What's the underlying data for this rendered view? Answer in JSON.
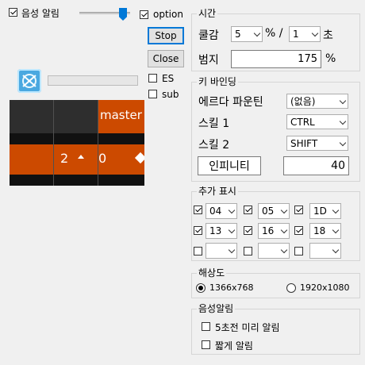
{
  "voice_alert": {
    "label": "음성 알림",
    "checked": true
  },
  "option": {
    "label": "option",
    "checked": true
  },
  "buttons": {
    "stop": "Stop",
    "close": "Close"
  },
  "es": {
    "label": "ES",
    "checked": false
  },
  "sub": {
    "label": "sub",
    "checked": false
  },
  "preview": {
    "top_text": "master",
    "bottom_value": "2",
    "bottom_right": "0",
    "colors": {
      "orange": "#cc4a00",
      "dark": "#2e2e2e"
    }
  },
  "time": {
    "title": "시간",
    "cooldown_label": "쿨감",
    "cooldown_value": "5",
    "percent_sep": "% /",
    "second_value": "1",
    "second_unit": "초",
    "width_label": "범지",
    "width_value": "175",
    "width_unit": "%"
  },
  "keybind": {
    "title": "키 바인딩",
    "rows": [
      {
        "label": "에르다 파운틴",
        "value": "(없음)"
      },
      {
        "label": "스킬 1",
        "value": "CTRL"
      },
      {
        "label": "스킬 2",
        "value": "SHIFT"
      }
    ],
    "infinity_label": "인피니티",
    "infinity_value": "40"
  },
  "extra": {
    "title": "추가 표시",
    "rows": [
      [
        {
          "checked": true,
          "value": "04"
        },
        {
          "checked": true,
          "value": "05"
        },
        {
          "checked": true,
          "value": "1D"
        }
      ],
      [
        {
          "checked": true,
          "value": "13"
        },
        {
          "checked": true,
          "value": "16"
        },
        {
          "checked": true,
          "value": "18"
        }
      ],
      [
        {
          "checked": false,
          "value": ""
        },
        {
          "checked": false,
          "value": ""
        },
        {
          "checked": false,
          "value": ""
        }
      ]
    ]
  },
  "resolution": {
    "title": "해상도",
    "opt1": "1366x768",
    "opt2": "1920x1080",
    "selected": "1366x768"
  },
  "voice": {
    "title": "음성알림",
    "opt1": "5초전 미리 알림",
    "opt2": "짧게 알림"
  }
}
